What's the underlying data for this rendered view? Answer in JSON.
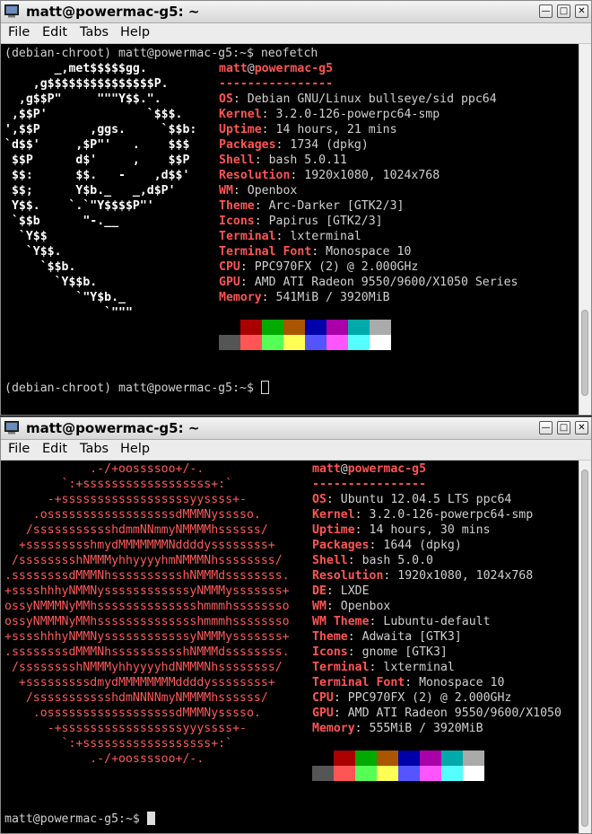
{
  "window1": {
    "title": "matt@powermac-g5: ~",
    "menu": [
      "File",
      "Edit",
      "Tabs",
      "Help"
    ],
    "command_line": "(debian-chroot) matt@powermac-g5:~$ neofetch",
    "logo": [
      "       _,met$$$$$gg.",
      "    ,g$$$$$$$$$$$$$$$P.",
      "  ,g$$P\"     \"\"\"Y$$.\".",
      " ,$$P'              `$$$.",
      "',$$P       ,ggs.     `$$b:",
      "`d$$'     ,$P\"'   .    $$$",
      " $$P      d$'     ,    $$P",
      " $$:      $$.   -    ,d$$'",
      " $$;      Y$b._   _,d$P'",
      " Y$$.    `.`\"Y$$$$P\"'",
      " `$$b      \"-.__",
      "  `Y$$",
      "   `Y$$.",
      "     `$$b.",
      "       `Y$$b.",
      "          `\"Y$b._",
      "              `\"\"\""
    ],
    "user": "matt",
    "at": "@",
    "host": "powermac-g5",
    "separator": "----------------",
    "info": [
      {
        "key": "OS",
        "value": "Debian GNU/Linux bullseye/sid ppc64"
      },
      {
        "key": "Kernel",
        "value": "3.2.0-126-powerpc64-smp"
      },
      {
        "key": "Uptime",
        "value": "14 hours, 21 mins"
      },
      {
        "key": "Packages",
        "value": "1734 (dpkg)"
      },
      {
        "key": "Shell",
        "value": "bash 5.0.11"
      },
      {
        "key": "Resolution",
        "value": "1920x1080, 1024x768"
      },
      {
        "key": "WM",
        "value": "Openbox"
      },
      {
        "key": "Theme",
        "value": "Arc-Darker [GTK2/3]"
      },
      {
        "key": "Icons",
        "value": "Papirus [GTK2/3]"
      },
      {
        "key": "Terminal",
        "value": "lxterminal"
      },
      {
        "key": "Terminal Font",
        "value": "Monospace 10"
      },
      {
        "key": "CPU",
        "value": "PPC970FX (2) @ 2.000GHz"
      },
      {
        "key": "GPU",
        "value": "AMD ATI Radeon 9550/9600/X1050 Series"
      },
      {
        "key": "Memory",
        "value": "541MiB / 3920MiB"
      }
    ],
    "prompt": "(debian-chroot) matt@powermac-g5:~$ "
  },
  "window2": {
    "title": "matt@powermac-g5: ~",
    "menu": [
      "File",
      "Edit",
      "Tabs",
      "Help"
    ],
    "logo": [
      "            .-/+oossssoo+/-.",
      "        `:+ssssssssssssssssss+:`",
      "      -+ssssssssssssssssssyyssss+-",
      "    .ossssssssssssssssssdMMMNysssso.",
      "   /ssssssssssshdmmNNmmyNMMMMhssssss/",
      "  +ssssssssshmydMMMMMMMNddddyssssssss+",
      " /sssssssshNMMMyhhyyyyhmNMMMNhssssssss/",
      ".ssssssssdMMMNhsssssssssshNMMMdssssssss.",
      "+sssshhhyNMMNyssssssssssssyNMMMysssssss+",
      "ossyNMMMNyMMhsssssssssssssshmmmhssssssso",
      "ossyNMMMNyMMhsssssssssssssshmmmhssssssso",
      "+sssshhhyNMMNyssssssssssssyNMMMysssssss+",
      ".ssssssssdMMMNhsssssssssshNMMMdssssssss.",
      " /sssssssshNMMMyhhyyyyhdNMMMNhssssssss/",
      "  +sssssssssdmydMMMMMMMMddddyssssssss+",
      "   /ssssssssssshdmNNNNmyNMMMMhssssss/",
      "    .ossssssssssssssssssdMMMNysssso.",
      "      -+sssssssssssssssssyyyssss+-",
      "        `:+ssssssssssssssssss+:`",
      "            .-/+oossssoo+/-."
    ],
    "user": "matt",
    "at": "@",
    "host": "powermac-g5",
    "separator": "----------------",
    "info": [
      {
        "key": "OS",
        "value": "Ubuntu 12.04.5 LTS ppc64"
      },
      {
        "key": "Kernel",
        "value": "3.2.0-126-powerpc64-smp"
      },
      {
        "key": "Uptime",
        "value": "14 hours, 30 mins"
      },
      {
        "key": "Packages",
        "value": "1644 (dpkg)"
      },
      {
        "key": "Shell",
        "value": "bash 5.0.0"
      },
      {
        "key": "Resolution",
        "value": "1920x1080, 1024x768"
      },
      {
        "key": "DE",
        "value": "LXDE"
      },
      {
        "key": "WM",
        "value": "Openbox"
      },
      {
        "key": "WM Theme",
        "value": "Lubuntu-default"
      },
      {
        "key": "Theme",
        "value": "Adwaita [GTK3]"
      },
      {
        "key": "Icons",
        "value": "gnome [GTK3]"
      },
      {
        "key": "Terminal",
        "value": "lxterminal"
      },
      {
        "key": "Terminal Font",
        "value": "Monospace 10"
      },
      {
        "key": "CPU",
        "value": "PPC970FX (2) @ 2.000GHz"
      },
      {
        "key": "GPU",
        "value": "AMD ATI Radeon 9550/9600/X1050"
      },
      {
        "key": "Memory",
        "value": "555MiB / 3920MiB"
      }
    ],
    "prompt": "matt@powermac-g5:~$ "
  },
  "palette": {
    "top": [
      "#000000",
      "#aa0000",
      "#00aa00",
      "#aa5500",
      "#0000aa",
      "#aa00aa",
      "#00aaaa",
      "#aaaaaa"
    ],
    "bottom": [
      "#555555",
      "#ff5555",
      "#55ff55",
      "#ffff55",
      "#5555ff",
      "#ff55ff",
      "#55ffff",
      "#ffffff"
    ]
  },
  "icons": {
    "app": "terminal-icon",
    "minimize": "minimize-icon",
    "maximize": "maximize-icon",
    "close": "close-icon"
  }
}
